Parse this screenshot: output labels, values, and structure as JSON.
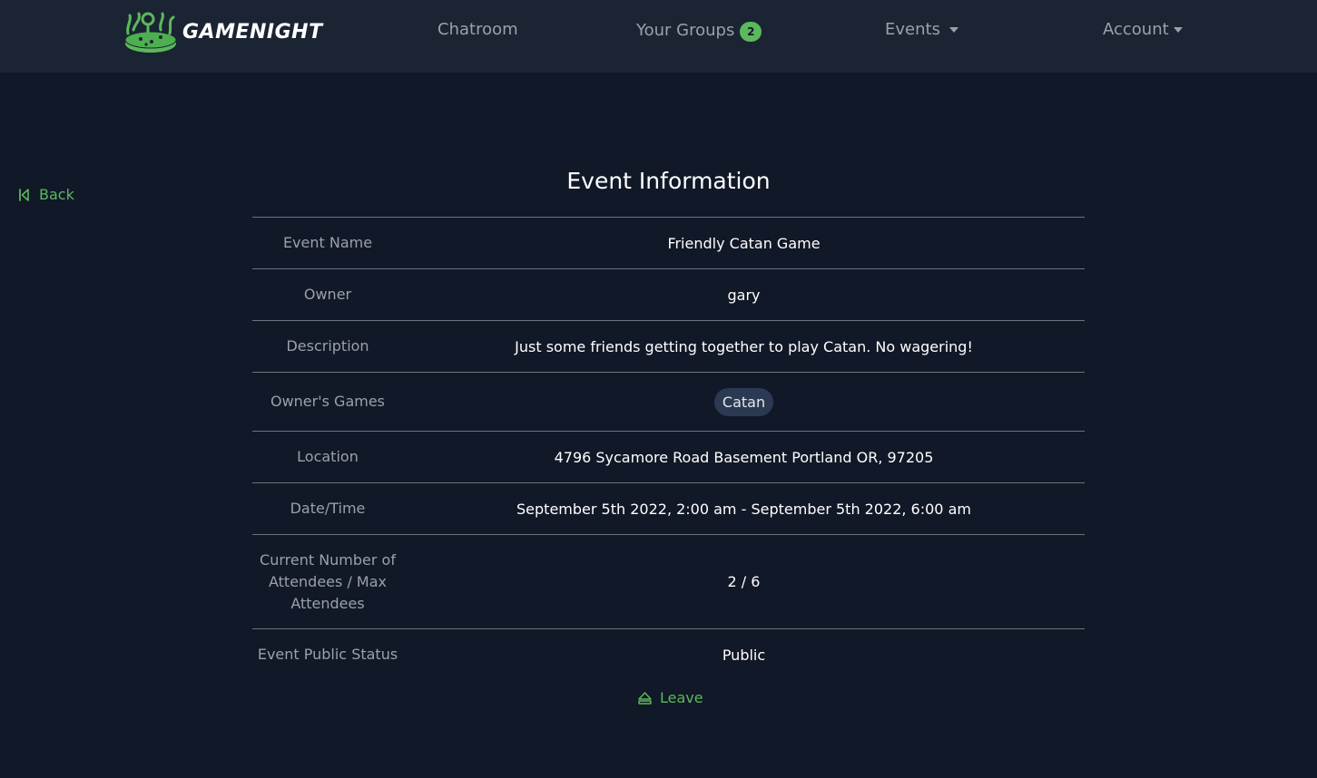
{
  "nav": {
    "brand": "GAMENIGHT",
    "chatroom": "Chatroom",
    "groups": "Your Groups",
    "groups_badge": "2",
    "events": "Events",
    "account": "Account"
  },
  "back": {
    "label": "Back"
  },
  "title": "Event Information",
  "rows": {
    "event_name": {
      "label": "Event Name",
      "value": "Friendly Catan Game"
    },
    "owner": {
      "label": "Owner",
      "value": "gary"
    },
    "description": {
      "label": "Description",
      "value": "Just some friends getting together to play Catan. No wagering!"
    },
    "games": {
      "label": "Owner's Games",
      "items": [
        "Catan"
      ]
    },
    "location": {
      "label": "Location",
      "value": "4796 Sycamore Road Basement Portland OR, 97205"
    },
    "datetime": {
      "label": "Date/Time",
      "value": "September 5th 2022, 2:00 am - September 5th 2022, 6:00 am"
    },
    "attendees": {
      "label": "Current Number of Attendees / Max Attendees",
      "value": "2 / 6"
    },
    "public_status": {
      "label": "Event Public Status",
      "value": "Public"
    }
  },
  "actions": {
    "leave": "Leave"
  },
  "colors": {
    "background": "#111827",
    "navbar": "#1b2433",
    "accent": "#5cb85c",
    "chip": "#2b3a52"
  },
  "icons": {
    "back": "skip-back-icon",
    "leave": "eject-icon",
    "logo": "game-pieces-logo"
  }
}
